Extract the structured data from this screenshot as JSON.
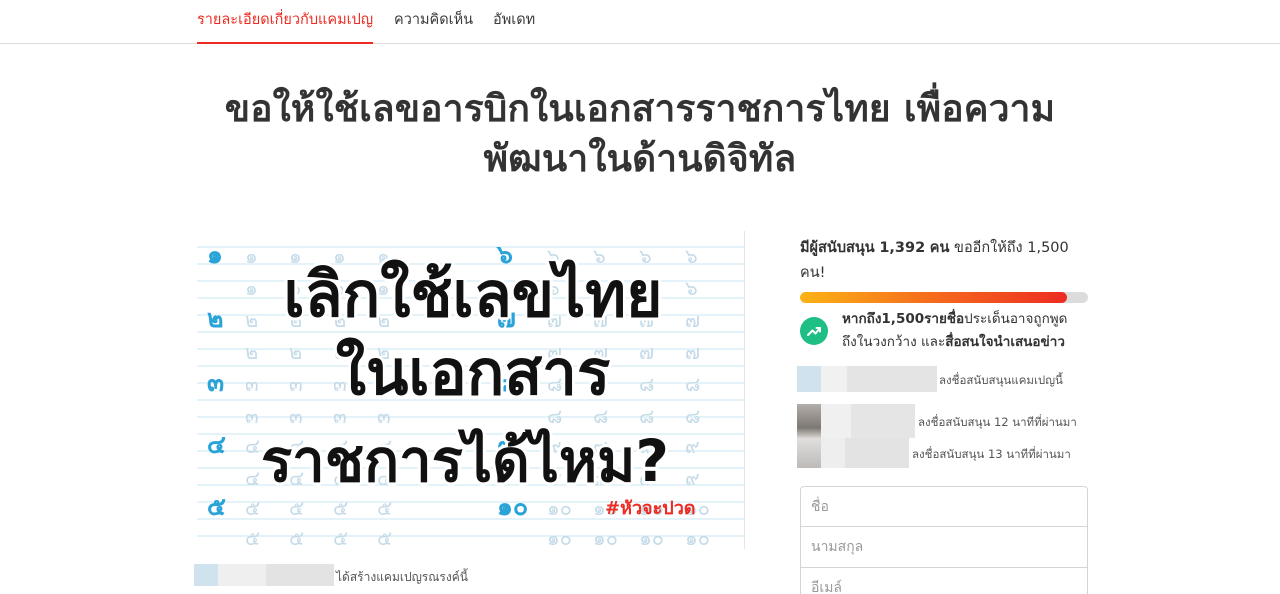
{
  "tabs": [
    {
      "label": "รายละเอียดเกี่ยวกับแคมเปญ",
      "active": true
    },
    {
      "label": "ความคิดเห็น",
      "active": false
    },
    {
      "label": "อัพเดท",
      "active": false
    }
  ],
  "title": {
    "line1": "ขอให้ใช้เลขอารบิกในเอกสารราชการไทย เพื่อความ",
    "line2": "พัฒนาในด้านดิจิทัล"
  },
  "hero": {
    "line1": "เลิกใช้เลขไทย",
    "line2": "ในเอกสาร",
    "line3": "ราชการได้ไหม?",
    "hashtag": "#หัวจะปวด",
    "thai_digits_left": [
      "๑",
      "๒",
      "๓",
      "๔",
      "๕"
    ],
    "thai_digits_right": [
      "๖",
      "๗",
      "๘",
      "๙",
      "๑๐"
    ]
  },
  "creator_text": "ได้สร้างแคมเปญรณรงค์นี้",
  "support": {
    "prefix": "มีผู้สนับสนุน",
    "count": "1,392",
    "unit": "คน",
    "remaining": "ขออีกให้ถึง 1,500",
    "remaining2": "คน!",
    "progress": 0.928,
    "milestone_bold1": "หากถึง1,500รายชื่อ",
    "milestone_text1": "ประเด็นอาจถูกพูด",
    "milestone_text2": "ถึงในวงกว้าง และ",
    "milestone_bold2": "สื่อสนใจนำเสนอข่าว"
  },
  "signers": [
    {
      "text": "ลงชื่อสนับสนุนแคมเปญนี้"
    },
    {
      "text": "ลงชื่อสนับสนุน 12 นาทีที่ผ่านมา"
    },
    {
      "text": "ลงชื่อสนับสนุน 13 นาทีที่ผ่านมา"
    }
  ],
  "form": {
    "first_name_placeholder": "ชื่อ",
    "last_name_placeholder": "นามสกุล",
    "email_placeholder": "อีเมล์"
  },
  "colors": {
    "accent": "#ec2c22",
    "progress_start": "#fbb315",
    "progress_end": "#ec2c22",
    "milestone_icon": "#1dbf85",
    "hero_digit_blue": "#2aa3d8"
  },
  "icons": {
    "milestone": "trending-up-icon"
  }
}
